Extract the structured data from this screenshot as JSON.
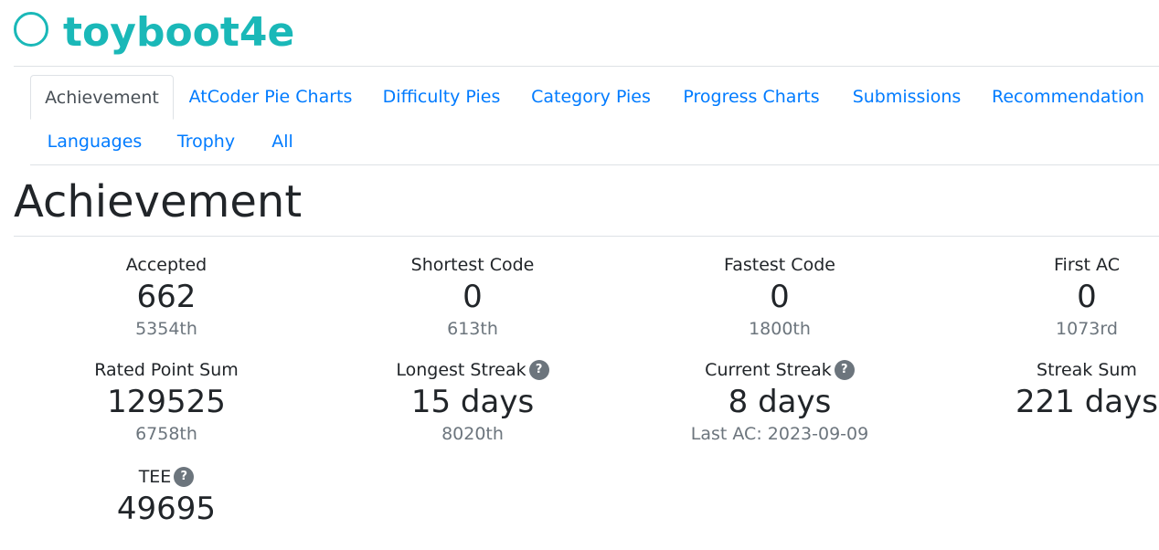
{
  "user": {
    "name": "toyboot4e",
    "color": "#1ab8b8"
  },
  "tabs": [
    {
      "label": "Achievement",
      "active": true
    },
    {
      "label": "AtCoder Pie Charts"
    },
    {
      "label": "Difficulty Pies"
    },
    {
      "label": "Category Pies"
    },
    {
      "label": "Progress Charts"
    },
    {
      "label": "Submissions"
    },
    {
      "label": "Recommendation"
    },
    {
      "label": "Languages"
    },
    {
      "label": "Trophy"
    },
    {
      "label": "All"
    }
  ],
  "page": {
    "title": "Achievement"
  },
  "stats": {
    "accepted": {
      "label": "Accepted",
      "value": "662",
      "rank": "5354th"
    },
    "shortest_code": {
      "label": "Shortest Code",
      "value": "0",
      "rank": "613th"
    },
    "fastest_code": {
      "label": "Fastest Code",
      "value": "0",
      "rank": "1800th"
    },
    "first_ac": {
      "label": "First AC",
      "value": "0",
      "rank": "1073rd"
    },
    "rated_point_sum": {
      "label": "Rated Point Sum",
      "value": "129525",
      "rank": "6758th"
    },
    "longest_streak": {
      "label": "Longest Streak",
      "value": "15 days",
      "rank": "8020th"
    },
    "current_streak": {
      "label": "Current Streak",
      "value": "8 days",
      "sub": "Last AC: 2023-09-09"
    },
    "streak_sum": {
      "label": "Streak Sum",
      "value": "221 days"
    },
    "tee": {
      "label": "TEE",
      "value": "49695"
    }
  },
  "help_icon_glyph": "?",
  "colors": {
    "link": "#007bff",
    "muted": "#6c757d",
    "border": "#dee2e6"
  }
}
